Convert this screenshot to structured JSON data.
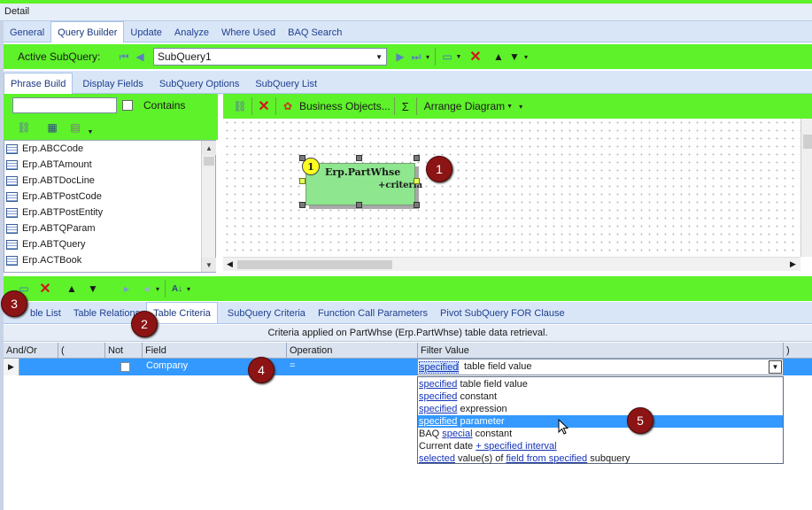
{
  "window": {
    "title": "Detail"
  },
  "main_tabs": [
    {
      "label": "General"
    },
    {
      "label": "Query Builder"
    },
    {
      "label": "Update"
    },
    {
      "label": "Analyze"
    },
    {
      "label": "Where Used"
    },
    {
      "label": "BAQ Search"
    }
  ],
  "subquery_bar": {
    "label": "Active SubQuery:",
    "selected": "SubQuery1"
  },
  "sub_tabs": [
    {
      "label": "Phrase Build"
    },
    {
      "label": "Display Fields"
    },
    {
      "label": "SubQuery Options"
    },
    {
      "label": "SubQuery List"
    }
  ],
  "search": {
    "value": "",
    "contains_label": "Contains"
  },
  "tables_list": [
    "Erp.ABCCode",
    "Erp.ABTAmount",
    "Erp.ABTDocLine",
    "Erp.ABTPostCode",
    "Erp.ABTPostEntity",
    "Erp.ABTQParam",
    "Erp.ABTQuery",
    "Erp.ACTBook"
  ],
  "diagram_toolbar": {
    "business_objects": "Business Objects...",
    "sigma": "Σ",
    "arrange": "Arrange Diagram"
  },
  "diagram": {
    "node": {
      "number": "1",
      "title": "Erp.PartWhse",
      "subtitle": "+criteria"
    },
    "node_color": "#8ee68e"
  },
  "bottom_tabs": [
    {
      "label": "ble List"
    },
    {
      "label": "Table Relations"
    },
    {
      "label": "Table Criteria"
    },
    {
      "label": "SubQuery Criteria"
    },
    {
      "label": "Function Call Parameters"
    },
    {
      "label": "Pivot SubQuery FOR Clause"
    }
  ],
  "criteria": {
    "caption": "Criteria applied on PartWhse (Erp.PartWhse)  table data retrieval.",
    "columns": [
      "And/Or",
      "(",
      "Not",
      "Field",
      "Operation",
      "Filter Value",
      ")"
    ],
    "row": {
      "field": "Company",
      "operation": "=",
      "filter_link": "specified",
      "filter_rest": "table field value"
    }
  },
  "dropdown_options": [
    {
      "parts": [
        {
          "t": "specified",
          "link": true
        },
        {
          "t": " table field value",
          "link": false
        }
      ]
    },
    {
      "parts": [
        {
          "t": "specified",
          "link": true
        },
        {
          "t": " constant",
          "link": false
        }
      ]
    },
    {
      "parts": [
        {
          "t": "specified",
          "link": true
        },
        {
          "t": " expression",
          "link": false
        }
      ]
    },
    {
      "parts": [
        {
          "t": "specified",
          "link": true
        },
        {
          "t": " parameter",
          "link": false
        }
      ],
      "selected": true
    },
    {
      "parts": [
        {
          "t": "BAQ ",
          "link": false
        },
        {
          "t": "special",
          "link": true
        },
        {
          "t": " constant",
          "link": false
        }
      ]
    },
    {
      "parts": [
        {
          "t": "Current date ",
          "link": false
        },
        {
          "t": "+ specified interval",
          "link": true
        }
      ]
    },
    {
      "parts": [
        {
          "t": "selected",
          "link": true
        },
        {
          "t": " value(s) of ",
          "link": false
        },
        {
          "t": "field from specified",
          "link": true
        },
        {
          "t": " subquery",
          "link": false
        }
      ]
    }
  ],
  "callouts": [
    "1",
    "2",
    "3",
    "4",
    "5"
  ],
  "colors": {
    "toolbar_green": "#5ef22a",
    "tab_strip": "#d9e6f7",
    "selection": "#3399ff",
    "callout": "#8c1414"
  }
}
